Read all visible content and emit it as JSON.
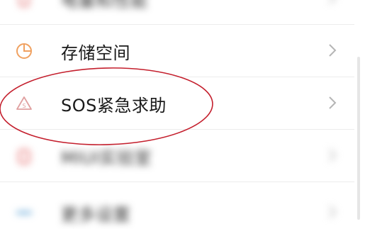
{
  "rows": [
    {
      "label": "电量和性能",
      "icon": "battery-icon",
      "color": "#d94b4b"
    },
    {
      "label": "存储空间",
      "icon": "storage-pie-icon",
      "color": "#f0a160"
    },
    {
      "label": "SOS紧急求助",
      "icon": "sos-alert-icon",
      "color": "#e0a0a0"
    },
    {
      "label": "MIUI实验室",
      "icon": "lab-flask-icon",
      "color": "#e35f5f"
    },
    {
      "label": "更多设置",
      "icon": "more-settings-icon",
      "color": "#67a8d8"
    }
  ],
  "annotation_color": "#c41f2d"
}
